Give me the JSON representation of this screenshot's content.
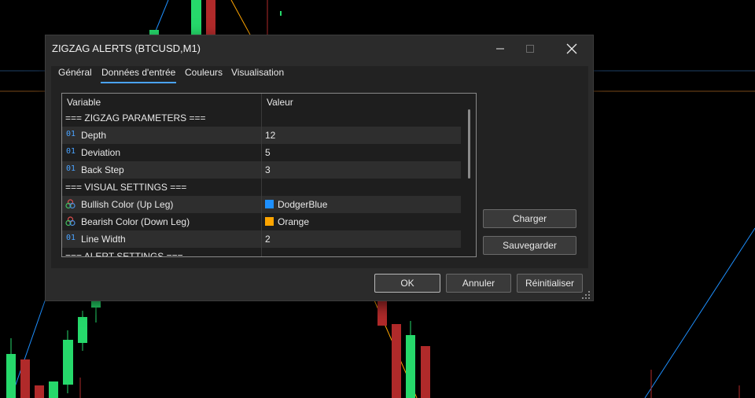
{
  "window": {
    "title": "ZIGZAG ALERTS (BTCUSD,M1)",
    "minimize_icon": "minimize-icon",
    "maximize_icon": "maximize-icon",
    "close_icon": "close-icon"
  },
  "tabs": [
    {
      "label": "Général",
      "active": false
    },
    {
      "label": "Données d'entrée",
      "active": true
    },
    {
      "label": "Couleurs",
      "active": false
    },
    {
      "label": "Visualisation",
      "active": false
    }
  ],
  "grid": {
    "header_variable": "Variable",
    "header_value": "Valeur",
    "rows": [
      {
        "variable": "=== ZIGZAG PARAMETERS ===",
        "value": "",
        "icon": "none"
      },
      {
        "variable": "Depth",
        "value": "12",
        "icon": "integer-icon"
      },
      {
        "variable": "Deviation",
        "value": "5",
        "icon": "integer-icon"
      },
      {
        "variable": "Back Step",
        "value": "3",
        "icon": "integer-icon"
      },
      {
        "variable": "=== VISUAL SETTINGS ===",
        "value": "",
        "icon": "none"
      },
      {
        "variable": "Bullish Color (Up Leg)",
        "value": "DodgerBlue",
        "icon": "color-icon",
        "swatch": "#1e90ff"
      },
      {
        "variable": "Bearish Color (Down Leg)",
        "value": "Orange",
        "icon": "color-icon",
        "swatch": "#ffa500"
      },
      {
        "variable": "Line Width",
        "value": "2",
        "icon": "integer-icon"
      },
      {
        "variable": "=== ALERT SETTINGS ===",
        "value": "",
        "icon": "none"
      }
    ],
    "integer_glyph": "01"
  },
  "buttons": {
    "load": "Charger",
    "save": "Sauvegarder",
    "ok": "OK",
    "cancel": "Annuler",
    "reset": "Réinitialiser"
  },
  "colors": {
    "accent": "#4aa3ff",
    "bull_candle": "#26d96b",
    "bear_candle": "#b02a2a",
    "zigzag_up": "#1e90ff",
    "zigzag_down": "#ffa500"
  }
}
